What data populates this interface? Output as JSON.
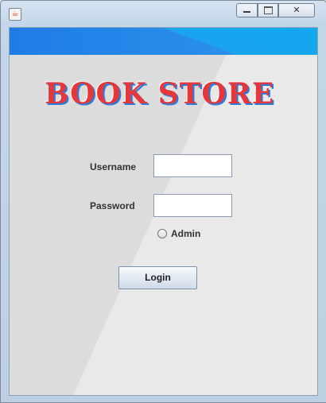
{
  "window": {
    "app_icon": "java-icon",
    "controls": {
      "minimize": "minimize-icon",
      "maximize": "maximize-icon",
      "close": "close-icon",
      "close_glyph": "✕"
    }
  },
  "logo": {
    "text": "BOOK STORE"
  },
  "form": {
    "username_label": "Username",
    "username_value": "",
    "password_label": "Password",
    "password_value": "",
    "admin_label": "Admin",
    "admin_selected": false,
    "login_label": "Login"
  },
  "colors": {
    "banner": "#1f7ce6",
    "logo_fill": "#e6373b",
    "logo_shadow": "#2a7bdc"
  }
}
